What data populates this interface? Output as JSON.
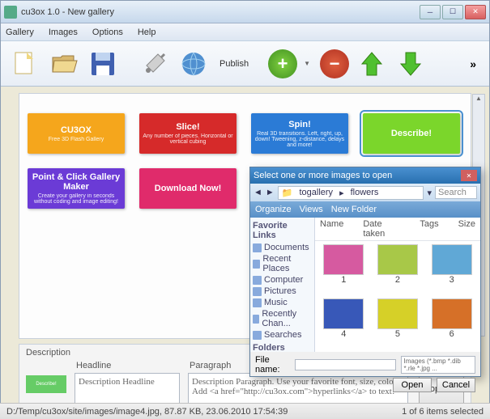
{
  "window": {
    "title": "cu3ox 1.0 - New gallery"
  },
  "menu": {
    "items": [
      "Gallery",
      "Images",
      "Options",
      "Help"
    ]
  },
  "toolbar": {
    "publish": "Publish"
  },
  "thumbs": [
    {
      "title": "CU3OX",
      "sub": "Free 3D Flash Gallery",
      "bg": "#f5a61c"
    },
    {
      "title": "Slice!",
      "sub": "Any number of pieces. Horizontal or vertical cubing",
      "bg": "#d62a2a"
    },
    {
      "title": "Spin!",
      "sub": "Real 3D transitions. Left, right, up, down! Tweening, z-distance, delays and more!",
      "bg": "#2b7bd6"
    },
    {
      "title": "Describe!",
      "sub": "",
      "bg": "#7bd62b",
      "selected": true
    },
    {
      "title": "Point & Click Gallery Maker",
      "sub": "Create your gallery in seconds without coding and image editing!",
      "bg": "#6b3bd6"
    },
    {
      "title": "Download Now!",
      "sub": "",
      "bg": "#e02b6b"
    }
  ],
  "description": {
    "label": "Description",
    "headline_label": "Headline",
    "paragraph_label": "Paragraph",
    "headline_value": "Description Headline",
    "paragraph_value": "Description Paragraph. Use your favorite font, size, color! Add <a href=\"http://cu3ox.com\">hyperlinks</a> to text!",
    "properties_btn": "Properties",
    "thumb_text": "Describe!"
  },
  "status": {
    "left": "D:/Temp/cu3ox/site/images/image4.jpg, 87.87 KB, 23.06.2010 17:54:39",
    "right": "1 of 6 items selected"
  },
  "dialog": {
    "title": "Select one or more images to open",
    "crumb1": "togallery",
    "crumb2": "flowers",
    "search_ph": "Search",
    "tb": {
      "organize": "Organize",
      "views": "Views",
      "newfolder": "New Folder"
    },
    "side_hdr": "Favorite Links",
    "side": [
      "Documents",
      "Recent Places",
      "Computer",
      "Pictures",
      "Music",
      "Recently Chan...",
      "Searches"
    ],
    "folders": "Folders",
    "cols": [
      "Name",
      "Date taken",
      "Tags",
      "Size"
    ],
    "files": [
      "1",
      "2",
      "3",
      "4",
      "5",
      "6"
    ],
    "file_colors": [
      "#d65aa0",
      "#a8c848",
      "#60a8d6",
      "#3858b8",
      "#d6d028",
      "#d67028"
    ],
    "filename_lbl": "File name:",
    "filter": "Images (*.bmp *.dib *.rle *.jpg ...",
    "open": "Open",
    "cancel": "Cancel"
  }
}
